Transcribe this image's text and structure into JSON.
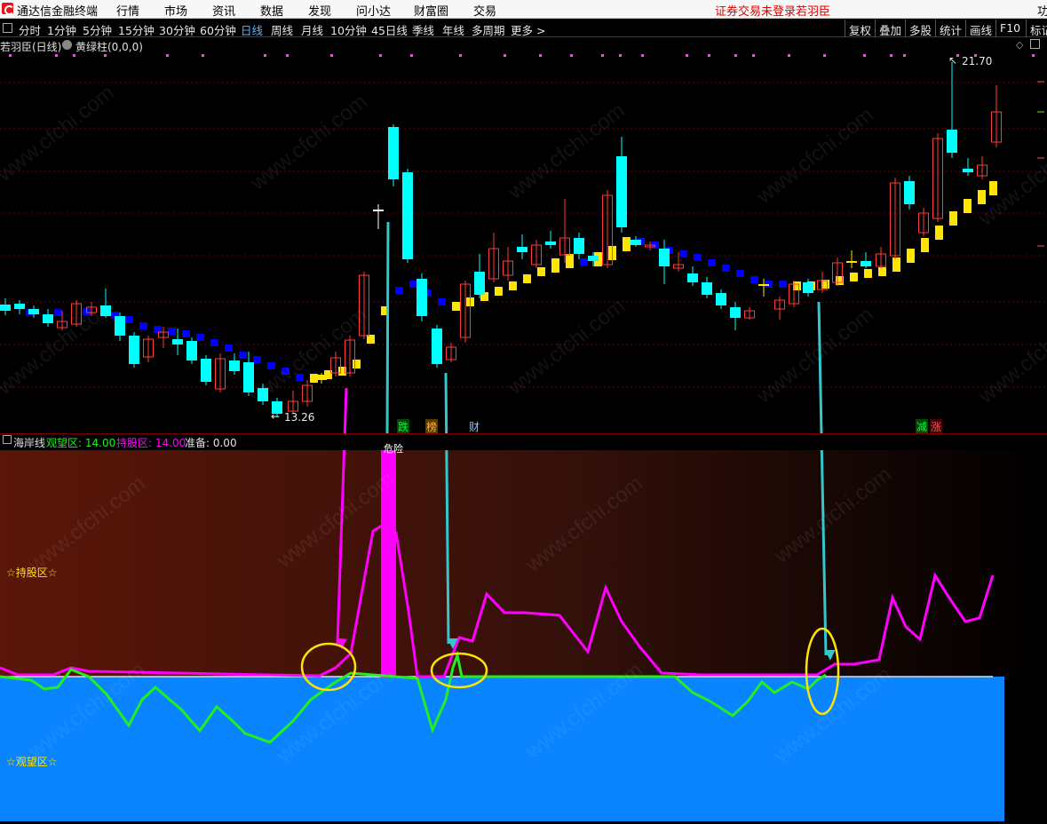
{
  "menu": {
    "app_title": "通达信金融终端",
    "items": [
      "行情",
      "市场",
      "资讯",
      "数据",
      "发现",
      "问小达",
      "财富圈",
      "交易"
    ],
    "login_status": "证券交易未登录",
    "username": "若羽臣",
    "right_edge_text": "功"
  },
  "periods": {
    "items": [
      "分时",
      "1分钟",
      "5分钟",
      "15分钟",
      "30分钟",
      "60分钟",
      "日线",
      "周线",
      "月线",
      "10分钟",
      "45日线",
      "季线",
      "年线",
      "多周期",
      "更多 >"
    ],
    "active": "日线"
  },
  "toolbar_right": [
    "复权",
    "叠加",
    "多股",
    "统计",
    "画线",
    "F10",
    "标记"
  ],
  "price_panel": {
    "stock_label": "若羽臣(日线)",
    "indicator_label": "黄绿柱(0,0,0)",
    "high_label": "21.70",
    "low_label": "13.26",
    "event_tags": [
      "跌",
      "榜",
      "财",
      "减",
      "涨"
    ],
    "colors": {
      "up": "#ff3c3c",
      "down": "#00ffff",
      "yellow": "#ffe400",
      "blue": "#0000ff"
    }
  },
  "indicator_panel": {
    "name": "海岸线",
    "watch_label": "观望区: 14.00",
    "hold_label": "持股区: 14.00",
    "ready_label": "准备: 0.00",
    "danger_label": "危险",
    "hold_zone_label": "☆持股区☆",
    "watch_zone_label": "☆观望区☆",
    "colors": {
      "hold_line": "#ff00ff",
      "watch_line": "#22ee22",
      "watch_fill": "#0a84ff"
    }
  },
  "watermark": "www.cfchi.com"
}
